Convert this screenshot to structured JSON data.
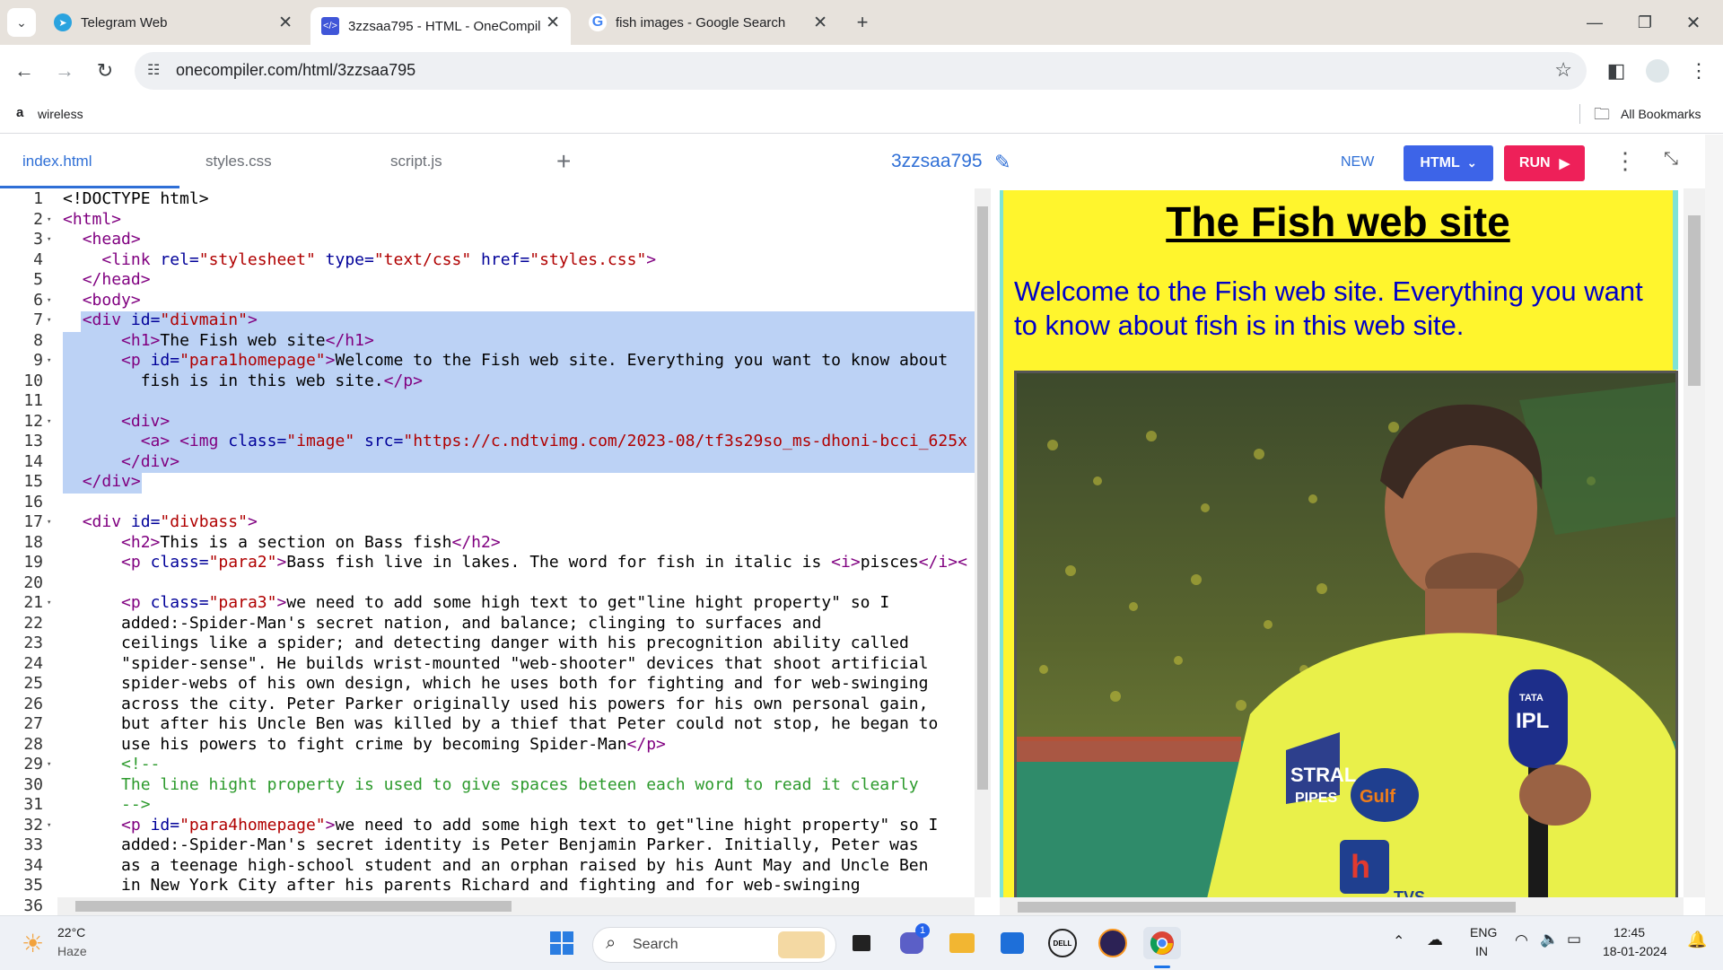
{
  "browser": {
    "tabs": [
      {
        "title": "Telegram Web",
        "icon": "telegram-icon",
        "active": false
      },
      {
        "title": "3zzsaa795 - HTML - OneCompil",
        "icon": "onecompiler-icon",
        "active": true
      },
      {
        "title": "fish images - Google Search",
        "icon": "google-icon",
        "active": false
      }
    ],
    "url": "onecompiler.com/html/3zzsaa795",
    "bookmarks": {
      "item": "wireless",
      "all": "All Bookmarks"
    }
  },
  "app": {
    "file_tabs": [
      "index.html",
      "styles.css",
      "script.js"
    ],
    "project_name": "3zzsaa795",
    "new_label": "NEW",
    "lang_label": "HTML",
    "run_label": "RUN"
  },
  "editor": {
    "line_numbers": [
      "1",
      "2",
      "3",
      "4",
      "5",
      "6",
      "7",
      "8",
      "9",
      "10",
      "11",
      "12",
      "13",
      "14",
      "15",
      "16",
      "17",
      "18",
      "19",
      "20",
      "21",
      "22",
      "23",
      "24",
      "25",
      "26",
      "27",
      "28",
      "29",
      "30",
      "31",
      "32",
      "33",
      "34",
      "35",
      "36"
    ]
  },
  "preview": {
    "heading": "The Fish web site",
    "paragraph": "Welcome to the Fish web site. Everything you want to know about fish is in this web site.",
    "image_text": [
      "STRAL",
      "PIPES",
      "Gulf",
      "TATA",
      "IPL",
      "TVS"
    ]
  },
  "taskbar": {
    "weather_temp": "22°C",
    "weather_desc": "Haze",
    "search_placeholder": "Search",
    "chat_badge": "1",
    "lang_top": "ENG",
    "lang_bottom": "IN",
    "time": "12:45",
    "date": "18-01-2024"
  },
  "colors": {
    "accent": "#2f6fd6",
    "run": "#ee2059",
    "lang_button": "#3d64e8",
    "preview_bg": "#fff52d",
    "selection": "#bcd2f5"
  }
}
